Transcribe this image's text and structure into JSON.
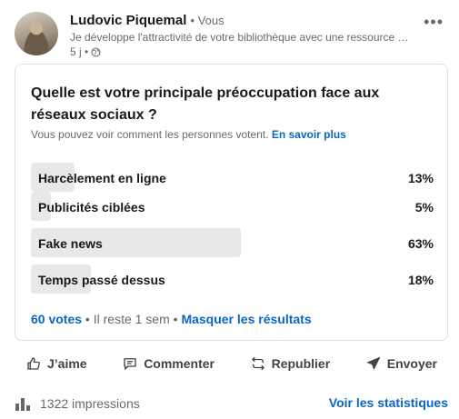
{
  "post": {
    "author_name": "Ludovic Piquemal",
    "author_relation": "• Vous",
    "headline": "Je développe l'attractivité de votre bibliothèque avec une ressource …",
    "age": "5 j •",
    "visibility_icon": "globe-icon",
    "more_label": "•••"
  },
  "poll": {
    "question": "Quelle est votre principale préoccupation face aux réseaux sociaux ?",
    "visibility_text": "Vous pouvez voir comment les personnes votent. ",
    "learn_more": "En savoir plus",
    "options": [
      {
        "label": "Harcèlement en ligne",
        "percent_text": "13%",
        "percent": 13
      },
      {
        "label": "Publicités ciblées",
        "percent_text": "5%",
        "percent": 5
      },
      {
        "label": "Fake news",
        "percent_text": "63%",
        "percent": 63
      },
      {
        "label": "Temps passé dessus",
        "percent_text": "18%",
        "percent": 18
      }
    ],
    "votes": "60 votes",
    "time_left": " • Il reste 1 sem • ",
    "hide_results": "Masquer les résultats"
  },
  "actions": {
    "like": "J’aime",
    "comment": "Commenter",
    "repost": "Republier",
    "send": "Envoyer"
  },
  "stats": {
    "impressions": "1322 impressions",
    "see_stats": "Voir les statistiques"
  },
  "colors": {
    "accent": "#0a66c2",
    "bar": "#e8e8e8"
  }
}
